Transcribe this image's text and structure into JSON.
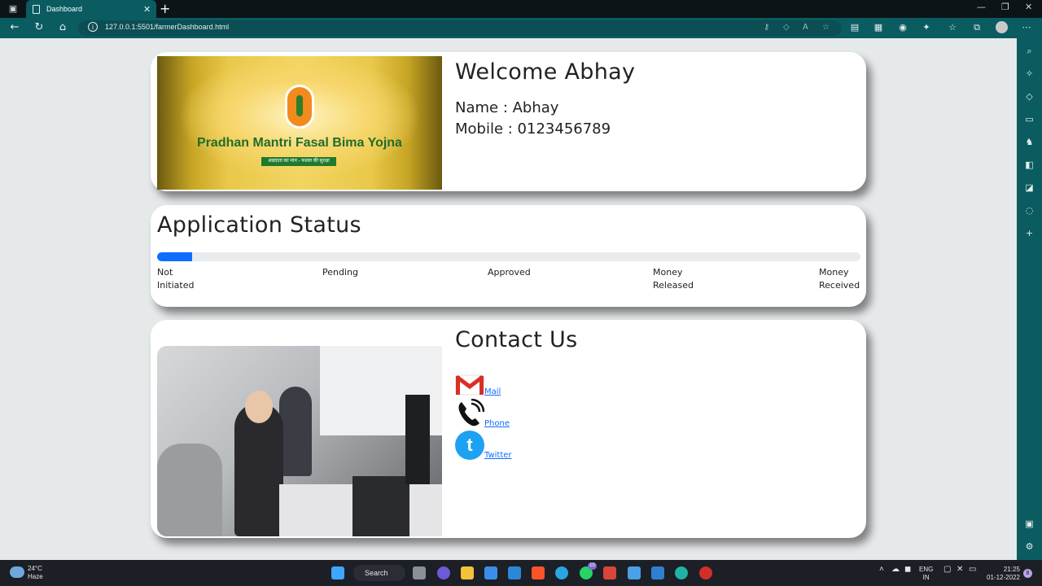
{
  "browser": {
    "tab_title": "Dashboard",
    "url": "127.0.0.1:5501/farmerDashboard.html"
  },
  "profile": {
    "banner_title": "Pradhan Mantri Fasal Bima Yojna",
    "banner_subtitle": "अन्नदाता का मान - फसल की सुरक्षा",
    "welcome": "Welcome Abhay",
    "name_line": "Name : Abhay",
    "mobile_line": "Mobile : 0123456789"
  },
  "status": {
    "title": "Application Status",
    "progress_percent": 5,
    "progress_color": "#0d6efd",
    "stages": [
      "Not Initiated",
      "Pending",
      "Approved",
      "Money Released",
      "Money Received"
    ]
  },
  "contact": {
    "title": "Contact Us",
    "links": [
      {
        "label": "Mail",
        "icon": "gmail-icon"
      },
      {
        "label": "Phone",
        "icon": "phone-icon"
      },
      {
        "label": "Twitter",
        "icon": "twitter-icon"
      }
    ]
  },
  "taskbar": {
    "weather_temp": "24°C",
    "weather_desc": "Haze",
    "search_label": "Search",
    "lang_line1": "ENG",
    "lang_line2": "IN",
    "time": "21:25",
    "date": "01-12-2022",
    "whatsapp_badge": "10",
    "notification_count": "8"
  }
}
